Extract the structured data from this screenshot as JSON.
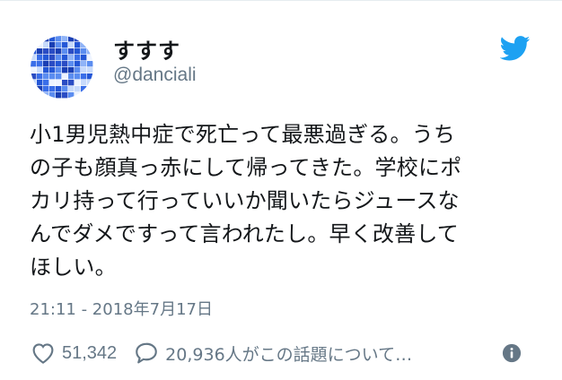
{
  "user": {
    "display_name": "すすす",
    "handle": "@danciali",
    "avatar_icon": "blue-mosaic-avatar"
  },
  "brand": {
    "icon": "twitter-bird-icon",
    "color": "#1da1f2"
  },
  "tweet": {
    "text": "小1男児熱中症で死亡って最悪過ぎる。うち\nの子も顔真っ赤にして帰ってきた。学校にポ\nカリ持って行っていいか聞いたらジュースな\nんでダメですって言われたし。早く改善して\nほしい。",
    "timestamp": "21:11 - 2018年7月17日"
  },
  "actions": {
    "likes_icon": "heart-icon",
    "likes": "51,342",
    "replies_icon": "speech-bubble-icon",
    "replies_text": "20,936人がこの話題について…",
    "info_icon": "info-icon"
  },
  "colors": {
    "text": "#14171a",
    "secondary": "#657786",
    "accent": "#1da1f2"
  }
}
